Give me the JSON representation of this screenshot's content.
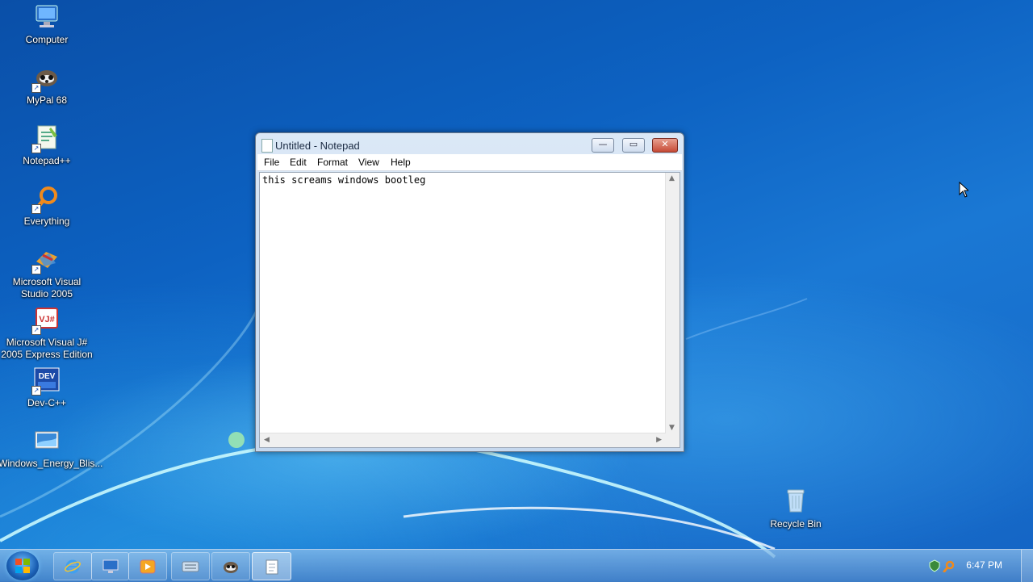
{
  "desktop": {
    "icons": [
      {
        "label": "Computer",
        "icon": "computer-icon"
      },
      {
        "label": "MyPal 68",
        "icon": "mypal-icon"
      },
      {
        "label": "Notepad++",
        "icon": "notepadpp-icon"
      },
      {
        "label": "Everything",
        "icon": "everything-icon"
      },
      {
        "label": "Microsoft Visual Studio 2005",
        "icon": "visual-studio-icon"
      },
      {
        "label": "Microsoft Visual J# 2005 Express Edition",
        "icon": "visual-jsharp-icon"
      },
      {
        "label": "Dev-C++",
        "icon": "devcpp-icon"
      },
      {
        "label": "Windows_Energy_Blis...",
        "icon": "image-file-icon"
      },
      {
        "label": "Recycle Bin",
        "icon": "recycle-bin-icon"
      }
    ]
  },
  "notepad": {
    "title": "Untitled - Notepad",
    "menu": [
      "File",
      "Edit",
      "Format",
      "View",
      "Help"
    ],
    "content": "this screams windows bootleg",
    "buttons": {
      "minimize": "—",
      "maximize": "▭",
      "close": "✕"
    }
  },
  "taskbar": {
    "clock": "6:47 PM",
    "pinned": [
      "internet-explorer-icon",
      "desktop-icon",
      "media-player-icon"
    ],
    "open": [
      "keyboard-icon",
      "mypal-icon",
      "notepad-icon"
    ]
  },
  "colors": {
    "accent": "#1a5fb4",
    "close": "#c64a36"
  }
}
